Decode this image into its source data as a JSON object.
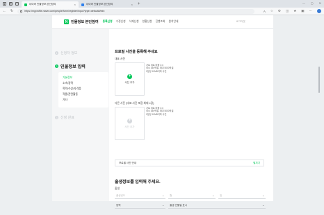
{
  "browser": {
    "tabs": [
      {
        "title": "네이버 인물정보 본인참여",
        "active": true
      },
      {
        "title": "네이버 인물정보 본인참여",
        "active": false
      }
    ],
    "url": "https://myprofile.naver.com/people/form/register/input?type=default#/info"
  },
  "header": {
    "logo": "N",
    "brand": "인물정보 본인참여",
    "nav": [
      "등록신청",
      "수정신청",
      "삭제신청",
      "현황신청",
      "진행조회",
      "원칙안내"
    ],
    "active_nav": 0,
    "login": "로그아웃"
  },
  "side": {
    "steps": [
      {
        "num": "1",
        "label": "신청자 정보"
      },
      {
        "num": "2",
        "label": "인물정보 입력"
      },
      {
        "num": "3",
        "label": "신청 완료"
      }
    ],
    "subitems": [
      "기본정보",
      "소속/경력",
      "학력/수상/자격증",
      "작품/관련활동",
      "기타"
    ],
    "active_sub": 0
  },
  "main": {
    "title": "프로필 사진을 등록해 주세요",
    "rep_label": "대표 사진",
    "add_label": "사진 추가",
    "rep_req": "가로 세로 비율 3:4\n최소 350픽셀, 최대 5000픽셀\n1장당 10MB이하 사진",
    "other_label": "다른 사진 (대표 사진 포함 최대 4장)",
    "other_req": "가로 세로 비율 3:4\n최소 350픽셀, 최대 5000픽셀\n1장당 10MB이하 사진",
    "guide_label": "프로필 사진 안내",
    "guide_link": "펼치기",
    "section2_title": "출생정보를 입력해 주세요.",
    "birth_label": "출생",
    "year_ph": "출생년도",
    "month_ph": "월",
    "day_ph": "일",
    "cal_value": "양력",
    "place_ph": "출생 년월일 표시"
  }
}
